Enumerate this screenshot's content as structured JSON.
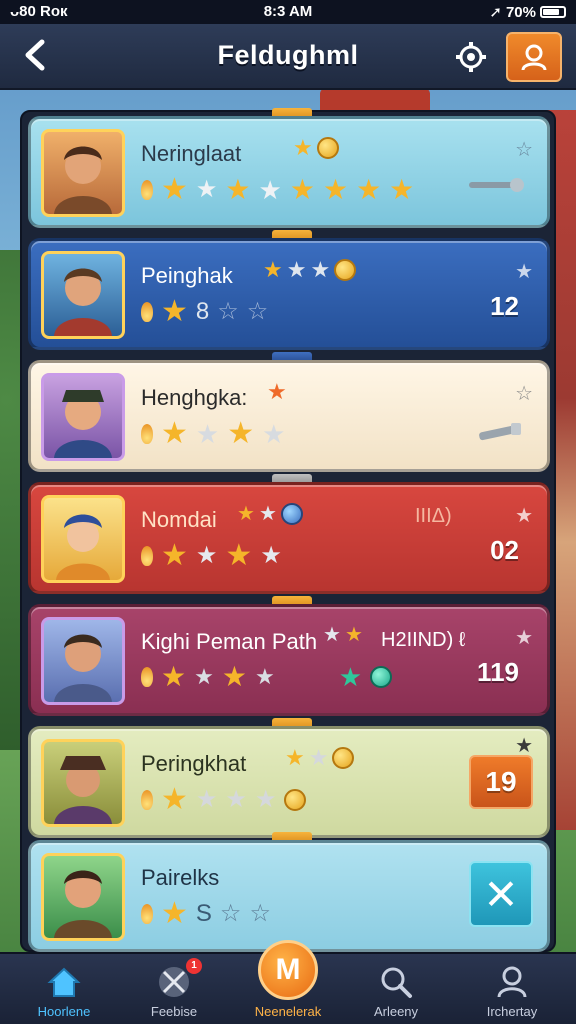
{
  "status_bar": {
    "carrier": "ᴗ80 Rок",
    "time": "8:3 AM",
    "battery": "70%",
    "battery_level": 0.7
  },
  "header": {
    "title": "Feldughml"
  },
  "players": [
    {
      "name": "Neringlaat",
      "value": "",
      "color": "#8fd3e6",
      "text_color": "#2b3a4a"
    },
    {
      "name": "Peinghak",
      "value": "12",
      "extra_num": "8",
      "color": "#2f5ea8",
      "text_color": "#ffffff"
    },
    {
      "name": "Henghgka:",
      "value": "",
      "color": "#f9efe0",
      "text_color": "#2b2b2b"
    },
    {
      "name": "Nomdai",
      "value": "02",
      "annot": "ΙΙΙΔ)",
      "color": "#c93b35",
      "text_color": "#ffe2c5"
    },
    {
      "name": "Kighi Peman Path",
      "value": "119",
      "annot": "H2ΙΙΝD) ℓ",
      "color": "#9b3a58",
      "text_color": "#ffffff"
    },
    {
      "name": "Peringkhat",
      "badge": "19",
      "color": "#dfe7b6",
      "text_color": "#2b3320"
    },
    {
      "name": "Pairelks",
      "extra_num": "S",
      "color": "#9fd8ea",
      "text_color": "#1f3346"
    }
  ],
  "nav": [
    {
      "label": "Hoorlene",
      "icon": "home-icon",
      "active": true
    },
    {
      "label": "Feebise",
      "icon": "crossed-swords-icon",
      "badge": "1"
    },
    {
      "label": "Neenelerak",
      "icon": "m-logo-icon",
      "center_letter": "M"
    },
    {
      "label": "Arleeny",
      "icon": "search-icon"
    },
    {
      "label": "Irchertay",
      "icon": "user-icon"
    }
  ],
  "icons": {
    "back": "chevron-left-icon",
    "settings": "gear-icon",
    "profile": "user-icon",
    "favorite": "star-outline-icon",
    "close": "close-icon"
  },
  "colors": {
    "header_bg": "#24304a",
    "accent_orange": "#e8751d",
    "accent_cyan": "#2aaed0",
    "gold": "#f5b52a"
  }
}
